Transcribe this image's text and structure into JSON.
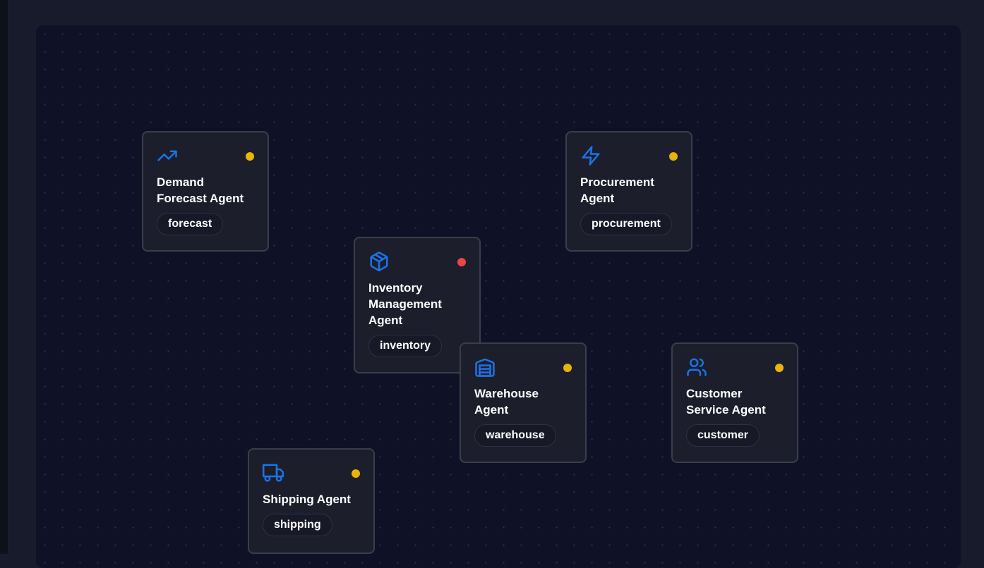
{
  "colors": {
    "accent": "#1a74e8",
    "status_warning": "#eab308",
    "status_error": "#ef4444"
  },
  "agents": [
    {
      "id": "forecast",
      "title": "Demand Forecast Agent",
      "tag": "forecast",
      "icon": "trending-up-icon",
      "status_color": "#eab308"
    },
    {
      "id": "procurement",
      "title": "Procurement Agent",
      "tag": "procurement",
      "icon": "zap-icon",
      "status_color": "#eab308"
    },
    {
      "id": "inventory",
      "title": "Inventory Management Agent",
      "tag": "inventory",
      "icon": "package-icon",
      "status_color": "#ef4444"
    },
    {
      "id": "warehouse",
      "title": "Warehouse Agent",
      "tag": "warehouse",
      "icon": "warehouse-icon",
      "status_color": "#eab308"
    },
    {
      "id": "customer",
      "title": "Customer Service Agent",
      "tag": "customer",
      "icon": "users-icon",
      "status_color": "#eab308"
    },
    {
      "id": "shipping",
      "title": "Shipping Agent",
      "tag": "shipping",
      "icon": "truck-icon",
      "status_color": "#eab308"
    }
  ]
}
